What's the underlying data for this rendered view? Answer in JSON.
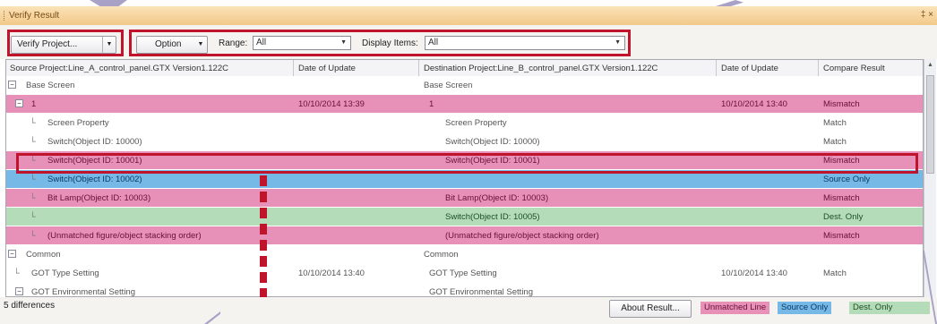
{
  "window": {
    "title": "Verify Result",
    "window_buttons": "‡ ×"
  },
  "toolbar": {
    "verify_label": "Verify Project...",
    "option_label": "Option",
    "range_label": "Range:",
    "range_value": "All",
    "display_label": "Display Items:",
    "display_value": "All"
  },
  "table": {
    "columns": [
      "Source Project:Line_A_control_panel.GTX  Version1.122C",
      "Date of Update",
      "Destination Project:Line_B_control_panel.GTX  Version1.122C",
      "Date of Update",
      "Compare Result"
    ],
    "rows": [
      {
        "type": "w",
        "src": "Base Screen",
        "src_date": "",
        "dst": "Base Screen",
        "dst_date": "",
        "result": ""
      },
      {
        "type": "mm",
        "src": "1",
        "src_date": "10/10/2014 13:39",
        "dst": "1",
        "dst_date": "10/10/2014 13:40",
        "result": "Mismatch"
      },
      {
        "type": "w",
        "src": "Screen Property",
        "src_date": "",
        "dst": "Screen Property",
        "dst_date": "",
        "result": "Match"
      },
      {
        "type": "w",
        "src": "Switch(Object ID: 10000)",
        "src_date": "",
        "dst": "Switch(Object ID: 10000)",
        "dst_date": "",
        "result": "Match"
      },
      {
        "type": "mm",
        "src": "Switch(Object ID: 10001)",
        "src_date": "",
        "dst": "Switch(Object ID: 10001)",
        "dst_date": "",
        "result": "Mismatch"
      },
      {
        "type": "so",
        "src": "Switch(Object ID: 10002)",
        "src_date": "",
        "dst": "",
        "dst_date": "",
        "result": "Source Only"
      },
      {
        "type": "mm",
        "src": "Bit Lamp(Object ID: 10003)",
        "src_date": "",
        "dst": "Bit Lamp(Object ID: 10003)",
        "dst_date": "",
        "result": "Mismatch"
      },
      {
        "type": "do",
        "src": "",
        "src_date": "",
        "dst": "Switch(Object ID: 10005)",
        "dst_date": "",
        "result": "Dest. Only"
      },
      {
        "type": "mm",
        "src": "(Unmatched figure/object stacking order)",
        "src_date": "",
        "dst": "(Unmatched figure/object stacking order)",
        "dst_date": "",
        "result": "Mismatch"
      },
      {
        "type": "w",
        "src": "Common",
        "src_date": "",
        "dst": "Common",
        "dst_date": "",
        "result": ""
      },
      {
        "type": "w",
        "src": "GOT Type Setting",
        "src_date": "10/10/2014 13:40",
        "dst": "GOT Type Setting",
        "dst_date": "10/10/2014 13:40",
        "result": "Match"
      },
      {
        "type": "w",
        "src": "GOT Environmental Setting",
        "src_date": "",
        "dst": "GOT Environmental Setting",
        "dst_date": "",
        "result": ""
      }
    ]
  },
  "status": {
    "count": "5 differences",
    "about_label": "About Result...",
    "legend_mismatch": "Unmatched Line",
    "legend_source": "Source Only",
    "legend_dest": "Dest. Only"
  },
  "colors": {
    "mismatch": "#e891b8",
    "source_only": "#76b8e6",
    "dest_only": "#b4dcb8",
    "highlight": "#c0142c"
  }
}
